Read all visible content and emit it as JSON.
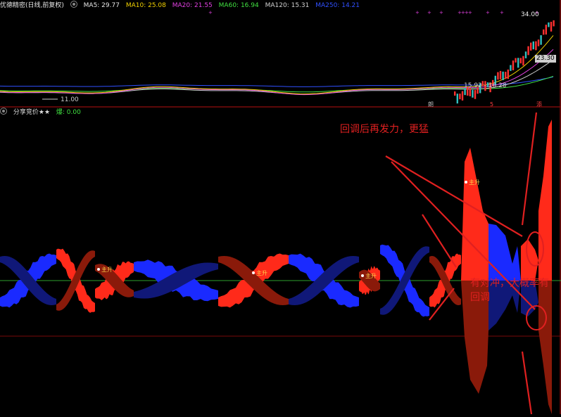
{
  "header": {
    "title": "优德精密(日线,前复权)",
    "ma_items": [
      {
        "label": "MA5: 29.77",
        "color": "#e6e6e6"
      },
      {
        "label": "MA10: 25.08",
        "color": "#f0d000"
      },
      {
        "label": "MA20: 21.55",
        "color": "#e040e0"
      },
      {
        "label": "MA60: 16.94",
        "color": "#40e040"
      },
      {
        "label": "MA120: 15.31",
        "color": "#cfcfcf"
      },
      {
        "label": "MA250: 14.21",
        "color": "#3050ff"
      }
    ]
  },
  "price_panel": {
    "low_label": "11.00",
    "high_label": "34.00",
    "current_label": "23.30",
    "range_label": "15.92 - 16.28",
    "bottom_marks": [
      "朗",
      "5",
      "添"
    ]
  },
  "indicator_panel": {
    "title": "分享竞价★★",
    "value_label": "爆: 0.00",
    "signal_label": "主升"
  },
  "annotations": {
    "upper": "回调后再发力，更猛",
    "lower_line1": "有对冲，大概率有",
    "lower_line2": "回调"
  },
  "colors": {
    "up_red": "#ff2a1a",
    "dark_red": "#8a1a0a",
    "down_blue": "#1a2aff",
    "dark_blue": "#101878",
    "panel_border": "#7a0a0a",
    "zero_line": "#2ea02e",
    "annotation_red": "#e02020"
  }
}
